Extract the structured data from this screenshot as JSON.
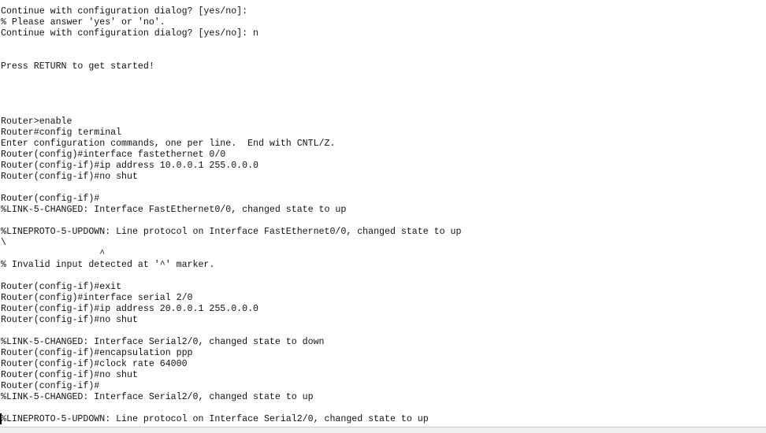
{
  "terminal": {
    "lines": [
      "Continue with configuration dialog? [yes/no]:",
      "% Please answer 'yes' or 'no'.",
      "Continue with configuration dialog? [yes/no]: n",
      "",
      "",
      "Press RETURN to get started!",
      "",
      "",
      "",
      "",
      "Router>enable",
      "Router#config terminal",
      "Enter configuration commands, one per line.  End with CNTL/Z.",
      "Router(config)#interface fastethernet 0/0",
      "Router(config-if)#ip address 10.0.0.1 255.0.0.0",
      "Router(config-if)#no shut",
      "",
      "Router(config-if)#",
      "%LINK-5-CHANGED: Interface FastEthernet0/0, changed state to up",
      "",
      "%LINEPROTO-5-UPDOWN: Line protocol on Interface FastEthernet0/0, changed state to up",
      "\\",
      "                  ^",
      "% Invalid input detected at '^' marker.",
      "",
      "Router(config-if)#exit",
      "Router(config)#interface serial 2/0",
      "Router(config-if)#ip address 20.0.0.1 255.0.0.0",
      "Router(config-if)#no shut",
      "",
      "%LINK-5-CHANGED: Interface Serial2/0, changed state to down",
      "Router(config-if)#encapsulation ppp",
      "Router(config-if)#clock rate 64000",
      "Router(config-if)#no shut",
      "Router(config-if)#",
      "%LINK-5-CHANGED: Interface Serial2/0, changed state to up",
      "",
      "%LINEPROTO-5-UPDOWN: Line protocol on Interface Serial2/0, changed state to up"
    ]
  }
}
